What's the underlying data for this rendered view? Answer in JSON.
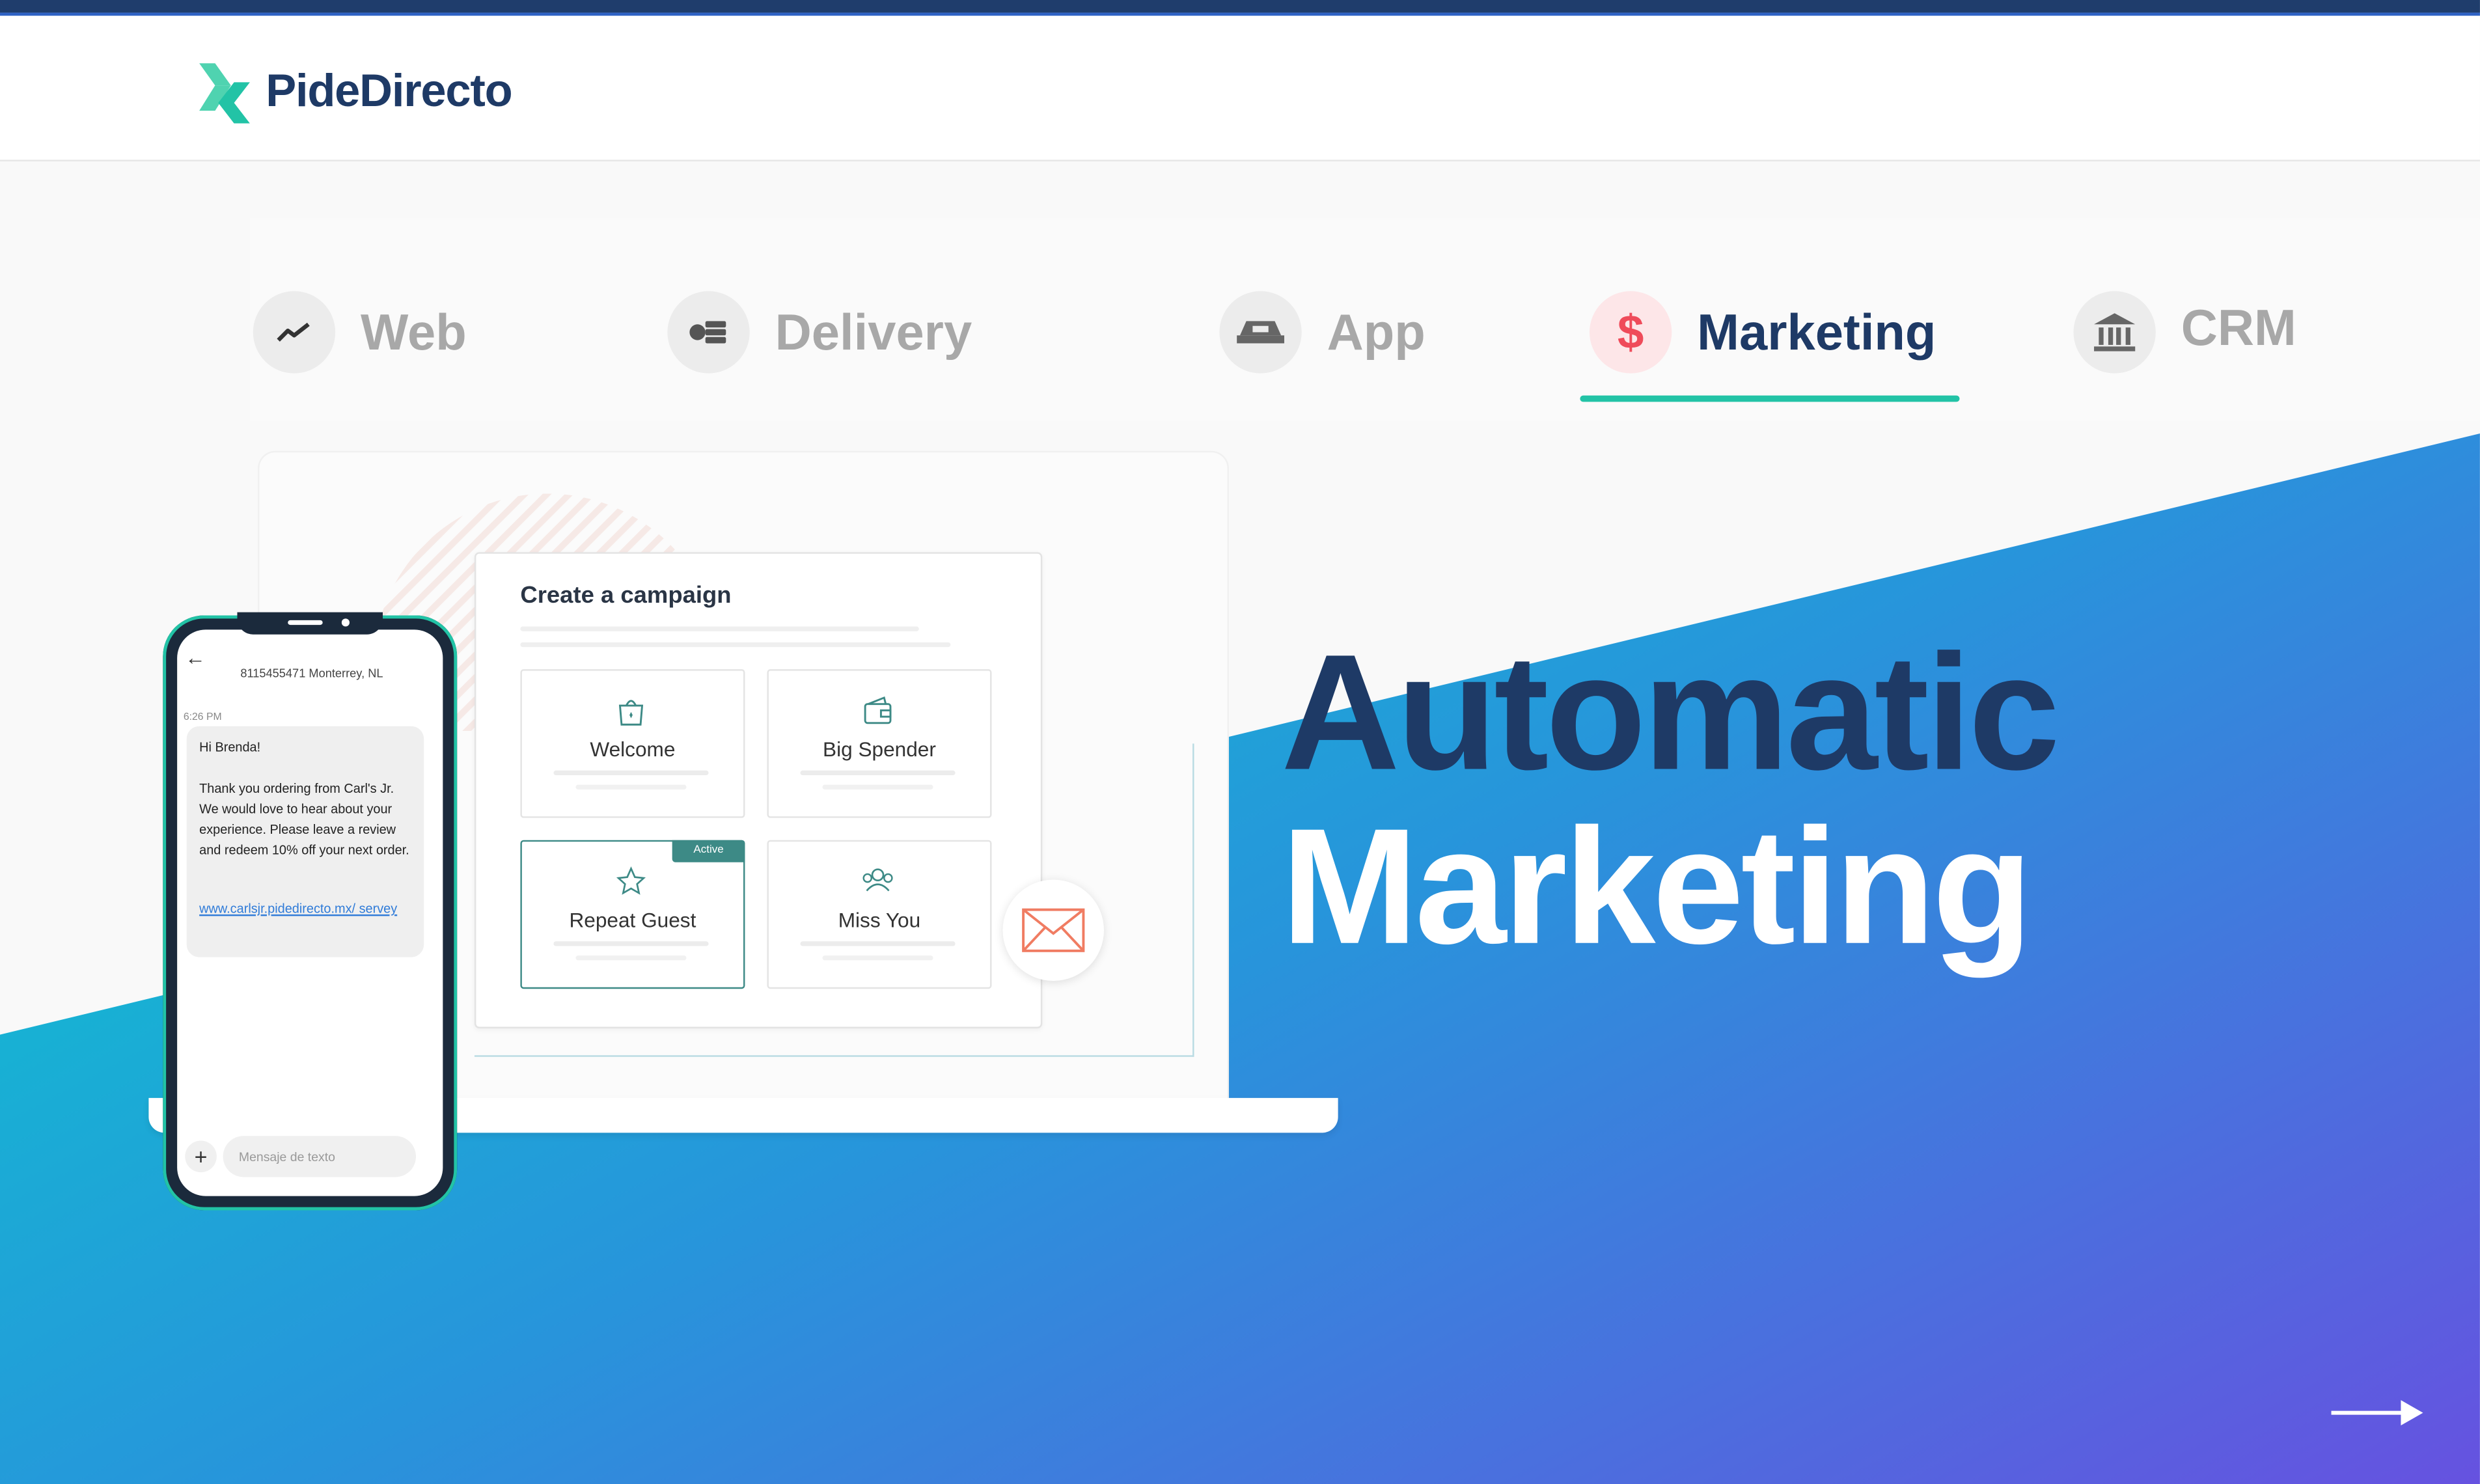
{
  "brand": {
    "name": "PideDirecto",
    "logo_colors": [
      "#4fd3b0",
      "#22c3a6"
    ],
    "text_color": "#1e3a66"
  },
  "tabs": [
    {
      "label": "Web",
      "icon": "trend-line-icon",
      "active": false
    },
    {
      "label": "Delivery",
      "icon": "delivery-icon",
      "active": false
    },
    {
      "label": "App",
      "icon": "app-icon",
      "active": false
    },
    {
      "label": "Marketing",
      "icon": "dollar-icon",
      "active": true
    },
    {
      "label": "CRM",
      "icon": "bank-icon",
      "active": false
    }
  ],
  "campaign": {
    "title": "Create a campaign",
    "cards": [
      {
        "label": "Welcome",
        "icon": "gift-bag-icon"
      },
      {
        "label": "Big Spender",
        "icon": "wallet-icon"
      },
      {
        "label": "Repeat Guest",
        "icon": "star-icon",
        "badge": "Active"
      },
      {
        "label": "Miss You",
        "icon": "people-icon"
      }
    ]
  },
  "phone": {
    "number": "8115455471 Monterrey, NL",
    "time": "6:26 PM",
    "greeting": "Hi Brenda!",
    "message": "Thank you ordering from Carl's Jr. We would love to hear about your experience. Please leave a review and redeem 10% off your next order.",
    "link": "www.carlsjr.pidedirecto.mx/ servey",
    "input_placeholder": "Mensaje de texto"
  },
  "headline": {
    "line1": "Automatic",
    "line2": "Marketing"
  },
  "colors": {
    "accent": "#22c3a6",
    "navy": "#1e3a66",
    "gradient_start": "#12c2d4",
    "gradient_end": "#6a4ee0",
    "mail": "#f07c62"
  }
}
